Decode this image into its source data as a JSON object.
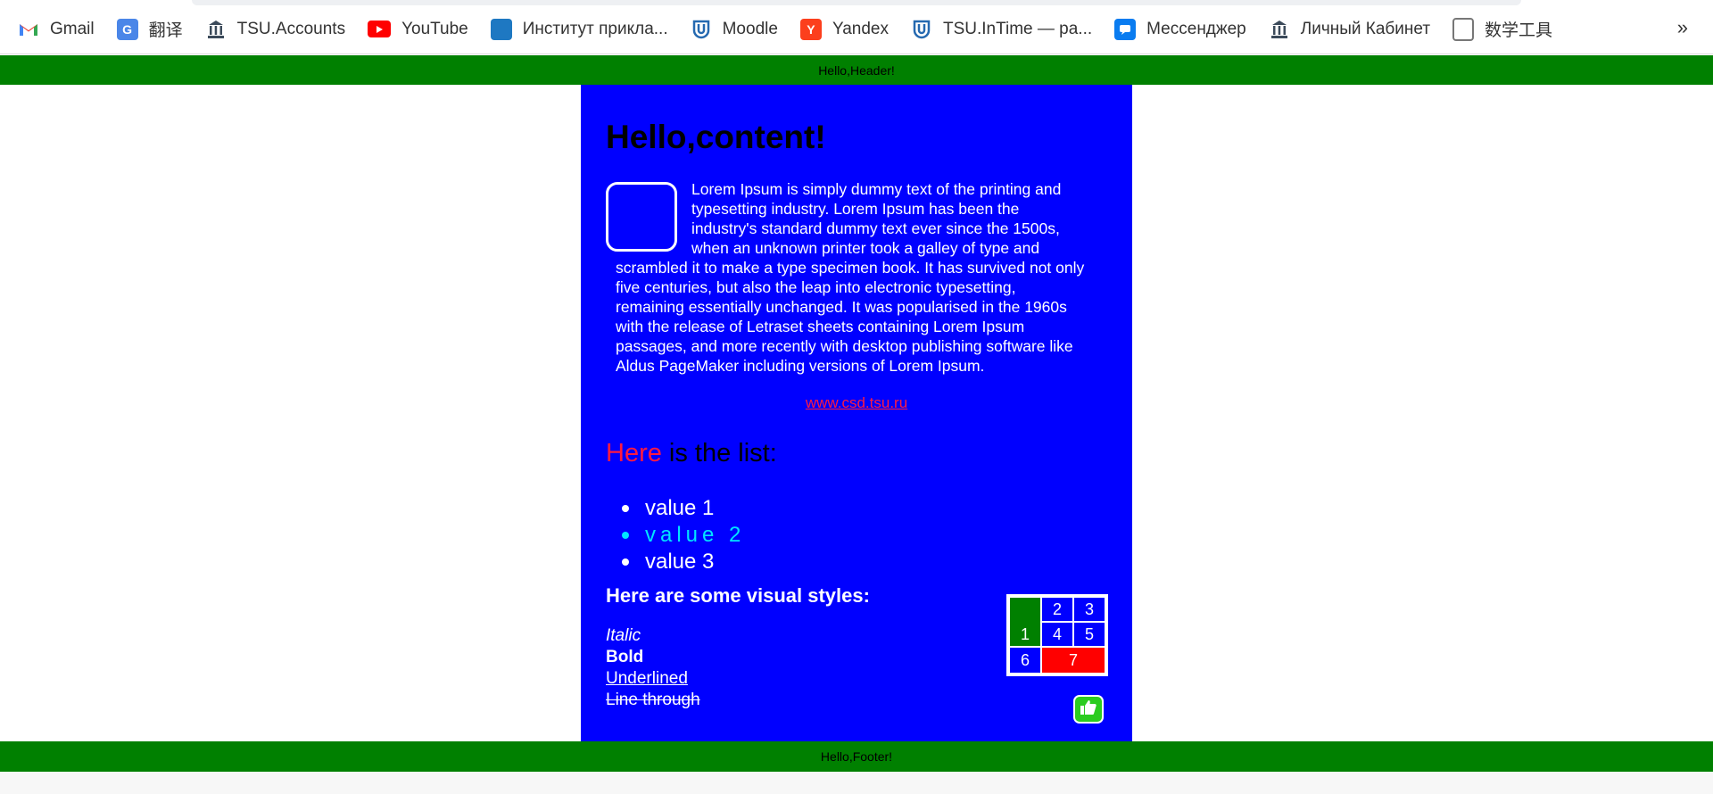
{
  "bookmarks": {
    "items": [
      {
        "label": "Gmail",
        "icon": "gmail-icon"
      },
      {
        "label": "翻译",
        "icon": "translate-icon"
      },
      {
        "label": "TSU.Accounts",
        "icon": "bank-icon"
      },
      {
        "label": "YouTube",
        "icon": "youtube-icon"
      },
      {
        "label": "Институт прикла...",
        "icon": "drupal-icon"
      },
      {
        "label": "Moodle",
        "icon": "moodle-icon"
      },
      {
        "label": "Yandex",
        "icon": "yandex-icon"
      },
      {
        "label": "TSU.InTime — ра...",
        "icon": "moodle-icon"
      },
      {
        "label": "Мессенджер",
        "icon": "chat-icon"
      },
      {
        "label": "Личный Кабинет",
        "icon": "bank-icon"
      },
      {
        "label": "数学工具",
        "icon": "page-icon"
      }
    ],
    "more": "»"
  },
  "header": {
    "text": "Hello,Header!"
  },
  "content": {
    "title": "Hello,content!",
    "lorem_lines": [
      "Lorem Ipsum is simply dummy text of the printing and",
      "typesetting industry. Lorem Ipsum has been the",
      "industry's standard dummy text ever since the 1500s,",
      "when an unknown printer took a galley of type and",
      "scrambled it to make a type specimen book. It has survived not only",
      "five centuries, but also the leap into electronic typesetting,",
      "remaining essentially unchanged. It was popularised in the 1960s",
      "with the release of Letraset sheets containing Lorem Ipsum",
      "passages, and more recently with desktop publishing software like",
      "Aldus PageMaker including versions of Lorem Ipsum."
    ],
    "link": "www.csd.tsu.ru",
    "list_title_highlight": "Here",
    "list_title_rest": " is the list:",
    "list_items": [
      "value 1",
      "value 2",
      "value 3"
    ],
    "styles_title": "Here are some visual styles:",
    "styles": {
      "italic": "Italic",
      "bold": "Bold",
      "underline": "Underlined",
      "through": "Line through"
    },
    "table_cells": [
      "1",
      "2",
      "3",
      "4",
      "5",
      "6",
      "7"
    ]
  },
  "footer": {
    "text": "Hello,Footer!"
  },
  "colors": {
    "header_footer": "#008000",
    "content_bg": "#0000ff",
    "link": "#ff1a40",
    "list_accent": "#00e5ff",
    "table_red": "#ff0000"
  }
}
